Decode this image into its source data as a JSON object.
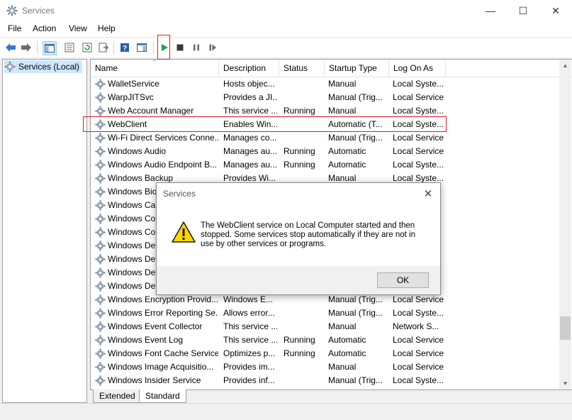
{
  "window": {
    "title": "Services",
    "minimize": "—",
    "maximize": "☐",
    "close": "✕"
  },
  "menu": [
    "File",
    "Action",
    "View",
    "Help"
  ],
  "tree": {
    "root_label": "Services (Local)"
  },
  "columns": [
    "Name",
    "Description",
    "Status",
    "Startup Type",
    "Log On As"
  ],
  "rows": [
    [
      "WalletService",
      "Hosts objec...",
      "",
      "Manual",
      "Local Syste..."
    ],
    [
      "WarpJITSvc",
      "Provides a JI...",
      "",
      "Manual (Trig...",
      "Local Service"
    ],
    [
      "Web Account Manager",
      "This service ...",
      "Running",
      "Manual",
      "Local Syste..."
    ],
    [
      "WebClient",
      "Enables Win...",
      "",
      "Automatic (T...",
      "Local Syste..."
    ],
    [
      "Wi-Fi Direct Services Conne...",
      "Manages co...",
      "",
      "Manual (Trig...",
      "Local Service"
    ],
    [
      "Windows Audio",
      "Manages au...",
      "Running",
      "Automatic",
      "Local Service"
    ],
    [
      "Windows Audio Endpoint B...",
      "Manages au...",
      "Running",
      "Automatic",
      "Local Syste..."
    ],
    [
      "Windows Backup",
      "Provides Wi...",
      "",
      "Manual",
      "Local Syste..."
    ],
    [
      "Windows Bio",
      "",
      "",
      "",
      ""
    ],
    [
      "Windows Car",
      "",
      "",
      "",
      ""
    ],
    [
      "Windows Cor",
      "",
      "",
      "",
      ""
    ],
    [
      "Windows Cor",
      "",
      "",
      "",
      ""
    ],
    [
      "Windows Def",
      "",
      "",
      "",
      ""
    ],
    [
      "Windows Def",
      "",
      "",
      "",
      ""
    ],
    [
      "Windows Def",
      "",
      "",
      "",
      ""
    ],
    [
      "Windows Def",
      "",
      "",
      "",
      ""
    ],
    [
      "Windows Encryption Provid...",
      "Windows E...",
      "",
      "Manual (Trig...",
      "Local Service"
    ],
    [
      "Windows Error Reporting Se...",
      "Allows error...",
      "",
      "Manual (Trig...",
      "Local Syste..."
    ],
    [
      "Windows Event Collector",
      "This service ...",
      "",
      "Manual",
      "Network S..."
    ],
    [
      "Windows Event Log",
      "This service ...",
      "Running",
      "Automatic",
      "Local Service"
    ],
    [
      "Windows Font Cache Service",
      "Optimizes p...",
      "Running",
      "Automatic",
      "Local Service"
    ],
    [
      "Windows Image Acquisitio...",
      "Provides im...",
      "",
      "Manual",
      "Local Service"
    ],
    [
      "Windows Insider Service",
      "Provides inf...",
      "",
      "Manual (Trig...",
      "Local Syste..."
    ]
  ],
  "tabs": {
    "extended": "Extended",
    "standard": "Standard"
  },
  "dialog": {
    "title": "Services",
    "message": "The WebClient service on Local Computer started and then stopped. Some services stop automatically if they are not in use by other services or programs.",
    "ok_label": "OK"
  },
  "colors": {
    "highlight": "#e0182b",
    "selection": "#cce8ff",
    "play_green": "#16a34a"
  }
}
